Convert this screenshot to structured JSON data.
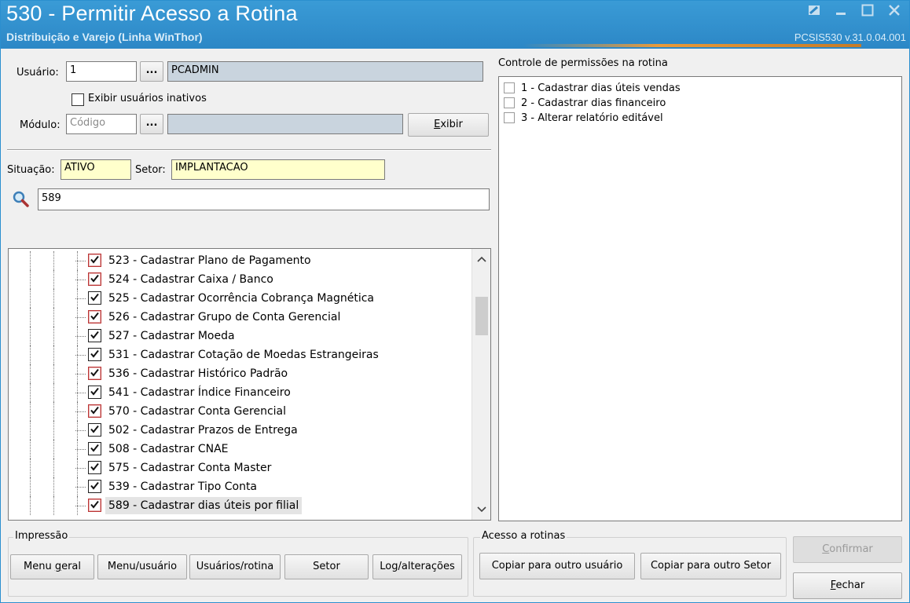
{
  "window": {
    "title": "530 - Permitir Acesso a Rotina",
    "subtitle": "Distribuição e Varejo (Linha WinThor)",
    "version": "PCSIS530  v.31.0.04.001"
  },
  "user": {
    "label": "Usuário:",
    "code": "1",
    "browse_label": "...",
    "name": "PCADMIN",
    "inactive_label": "Exibir usuários inativos"
  },
  "module": {
    "label": "Módulo:",
    "placeholder": "Código",
    "browse_label": "...",
    "name": "",
    "show_button": "Exibir"
  },
  "status": {
    "situacao_label": "Situação:",
    "situacao_value": "ATIVO",
    "setor_label": "Setor:",
    "setor_value": "IMPLANTACAO"
  },
  "search": {
    "value": "589",
    "icon": "search-icon"
  },
  "tree": {
    "items": [
      {
        "label": "523 - Cadastrar Plano de Pagamento",
        "checked": true,
        "highlight": true
      },
      {
        "label": "524 - Cadastrar Caixa / Banco",
        "checked": true,
        "highlight": true
      },
      {
        "label": "525 - Cadastrar Ocorrência Cobrança Magnética",
        "checked": true,
        "highlight": false
      },
      {
        "label": "526 - Cadastrar Grupo de Conta Gerencial",
        "checked": true,
        "highlight": true
      },
      {
        "label": "527 - Cadastrar Moeda",
        "checked": true,
        "highlight": false
      },
      {
        "label": "531 - Cadastrar Cotação de Moedas Estrangeiras",
        "checked": true,
        "highlight": false
      },
      {
        "label": "536 - Cadastrar Histórico Padrão",
        "checked": true,
        "highlight": true
      },
      {
        "label": "541 - Cadastrar Índice Financeiro",
        "checked": true,
        "highlight": false
      },
      {
        "label": "570 - Cadastrar Conta Gerencial",
        "checked": true,
        "highlight": true
      },
      {
        "label": "502 - Cadastrar Prazos de Entrega",
        "checked": true,
        "highlight": false
      },
      {
        "label": "508 - Cadastrar CNAE",
        "checked": true,
        "highlight": false
      },
      {
        "label": "575 - Cadastrar Conta Master",
        "checked": true,
        "highlight": false
      },
      {
        "label": "539 - Cadastrar Tipo Conta",
        "checked": true,
        "highlight": false
      },
      {
        "label": "589 - Cadastrar dias úteis por filial",
        "checked": true,
        "highlight": true,
        "selected": true
      }
    ]
  },
  "permissions": {
    "title": "Controle de permissões na rotina",
    "items": [
      {
        "label": "1 - Cadastrar dias úteis vendas",
        "checked": false
      },
      {
        "label": "2 - Cadastrar dias financeiro",
        "checked": false
      },
      {
        "label": "3 - Alterar relatório editável",
        "checked": false
      }
    ]
  },
  "impressao": {
    "label": "Impressão",
    "buttons": [
      "Menu geral",
      "Menu/usuário",
      "Usuários/rotina",
      "Setor",
      "Log/alterações"
    ]
  },
  "acesso": {
    "label": "Acesso a rotinas",
    "buttons": [
      "Copiar para outro usuário",
      "Copiar para outro Setor"
    ]
  },
  "actions": {
    "confirm": "Confirmar",
    "close": "Fechar"
  },
  "colors": {
    "titlebar": "#2c87c6",
    "highlight_checkbox": "#b33333",
    "readonly_field": "#ffffcc"
  }
}
